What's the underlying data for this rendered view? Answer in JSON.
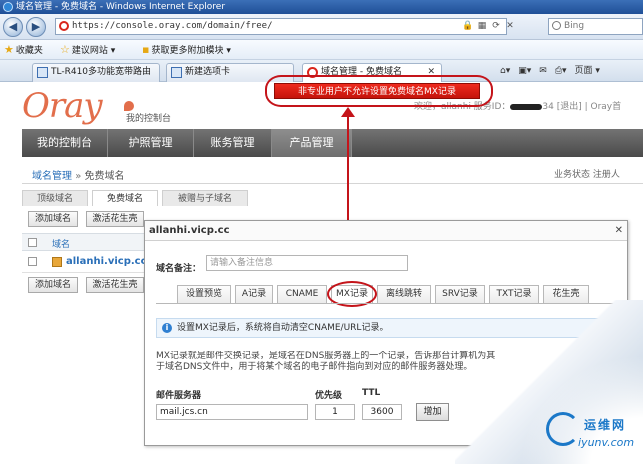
{
  "window": {
    "title": "域名管理 - 免费域名 - Windows Internet Explorer"
  },
  "address": {
    "url": "https://console.oray.com/domain/free/",
    "search_placeholder": "Bing"
  },
  "favorites": {
    "label": "收藏夹",
    "items": [
      "建议网站 ▾",
      "获取更多附加模块 ▾"
    ]
  },
  "tabs": [
    {
      "label": "TL-R410多功能宽带路由器"
    },
    {
      "label": "新建选项卡"
    },
    {
      "label": "域名管理 - 免费域名"
    }
  ],
  "command_bar": {
    "page_label": "页面 ▾"
  },
  "header": {
    "logo": "Oray",
    "logo_sub": "我的控制台",
    "welcome_prefix": "欢迎，allanhi 服务ID：",
    "welcome_suffix": "34 [退出] | Oray首"
  },
  "main_nav": [
    "我的控制台",
    "护照管理",
    "账务管理",
    "产品管理"
  ],
  "breadcrumb": {
    "root": "域名管理",
    "separator": "»",
    "current": "免费域名"
  },
  "breadcrumb_right": "业务状态  注册人",
  "sub_tabs": [
    "顶级域名",
    "免费域名",
    "被赠与子域名"
  ],
  "toolbar": {
    "add_domain": "添加域名",
    "activate": "激活花生壳"
  },
  "list": {
    "header": "域名",
    "rows": [
      {
        "domain": "allanhi.vicp.cc"
      }
    ]
  },
  "warning": {
    "text": "非专业用户不允许设置免费域名MX记录"
  },
  "modal": {
    "title": "allanhi.vicp.cc",
    "close": "✕",
    "note_label": "域名备注：",
    "note_placeholder": "请输入备注信息",
    "record_tabs": [
      "设置预览",
      "A记录",
      "CNAME",
      "MX记录",
      "离线跳转",
      "SRV记录",
      "TXT记录",
      "花生壳"
    ],
    "info": "设置MX记录后，系统将自动清空CNAME/URL记录。",
    "desc_line1": "MX记录就是邮件交换记录，是域名在DNS服务器上的一个记录，告诉那台计算机为其",
    "desc_line2": "于域名DNS文件中，用于将某个域名的电子邮件指向到对应的邮件服务器处理。",
    "fields": {
      "server_label": "邮件服务器",
      "priority_label": "优先级",
      "ttl_label": "TTL",
      "server_value": "mail.jcs.cn",
      "priority_value": "1",
      "ttl_value": "3600",
      "add_button": "增加"
    }
  },
  "watermark": {
    "line1": "运维网",
    "line2": "iyunv.com"
  },
  "colors": {
    "accent_red": "#c4141a",
    "nav_gray": "#5a5a5a",
    "link_blue": "#2a6fb8",
    "oray_orange": "#e26e4b"
  }
}
